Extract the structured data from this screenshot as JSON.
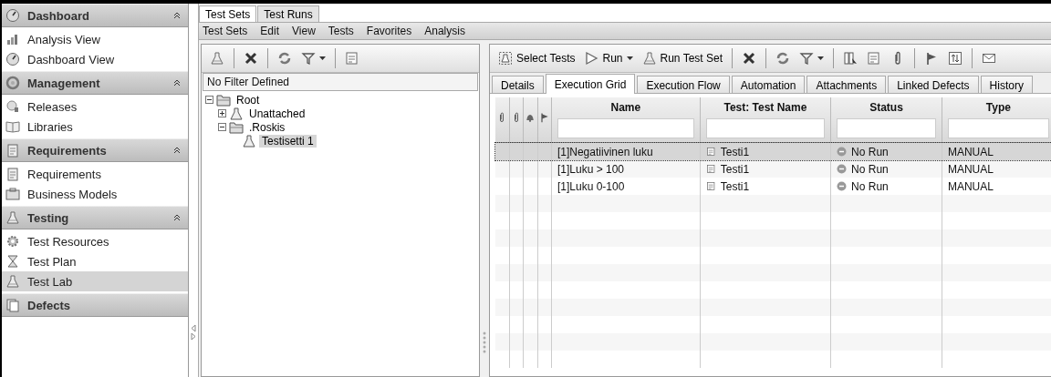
{
  "sidebar": {
    "sections": [
      {
        "title": "Dashboard",
        "expanded": true,
        "items": [
          {
            "label": "Analysis View",
            "selected": false
          },
          {
            "label": "Dashboard View",
            "selected": false
          }
        ]
      },
      {
        "title": "Management",
        "expanded": true,
        "items": [
          {
            "label": "Releases",
            "selected": false
          },
          {
            "label": "Libraries",
            "selected": false
          }
        ]
      },
      {
        "title": "Requirements",
        "expanded": true,
        "items": [
          {
            "label": "Requirements",
            "selected": false
          },
          {
            "label": "Business Models",
            "selected": false
          }
        ]
      },
      {
        "title": "Testing",
        "expanded": true,
        "items": [
          {
            "label": "Test Resources",
            "selected": false
          },
          {
            "label": "Test Plan",
            "selected": false
          },
          {
            "label": "Test Lab",
            "selected": true
          }
        ]
      },
      {
        "title": "Defects",
        "expanded": false
      }
    ]
  },
  "module_tabs": [
    {
      "label": "Test Sets",
      "selected": true
    },
    {
      "label": "Test Runs",
      "selected": false
    }
  ],
  "menu": [
    "Test Sets",
    "Edit",
    "View",
    "Tests",
    "Favorites",
    "Analysis"
  ],
  "tree_panel": {
    "filter_text": "No Filter Defined",
    "tree": [
      {
        "label": "Root",
        "kind": "folder",
        "expanded": true,
        "selected": false,
        "children": [
          {
            "label": "Unattached",
            "kind": "test-set",
            "expanded": false,
            "selected": false
          },
          {
            "label": ".Roskis",
            "kind": "folder",
            "expanded": true,
            "selected": false,
            "children": [
              {
                "label": "Testisetti 1",
                "kind": "test-set",
                "selected": true
              }
            ]
          }
        ]
      }
    ]
  },
  "details_panel": {
    "toolbar_buttons": [
      "Select Tests",
      "Run",
      "Run Test Set"
    ],
    "tabs": [
      {
        "label": "Details",
        "selected": false
      },
      {
        "label": "Execution Grid",
        "selected": true
      },
      {
        "label": "Execution Flow",
        "selected": false
      },
      {
        "label": "Automation",
        "selected": false
      },
      {
        "label": "Attachments",
        "selected": false
      },
      {
        "label": "Linked Defects",
        "selected": false
      },
      {
        "label": "History",
        "selected": false
      }
    ],
    "grid": {
      "columns": [
        "Name",
        "Test: Test Name",
        "Status",
        "Type"
      ],
      "rows": [
        {
          "name": "[1]Negatiivinen luku",
          "test_name": "Testi1",
          "status": "No Run",
          "type": "MANUAL",
          "selected": true
        },
        {
          "name": "[1]Luku > 100",
          "test_name": "Testi1",
          "status": "No Run",
          "type": "MANUAL",
          "selected": false
        },
        {
          "name": "[1]Luku 0-100",
          "test_name": "Testi1",
          "status": "No Run",
          "type": "MANUAL",
          "selected": false
        }
      ]
    }
  }
}
